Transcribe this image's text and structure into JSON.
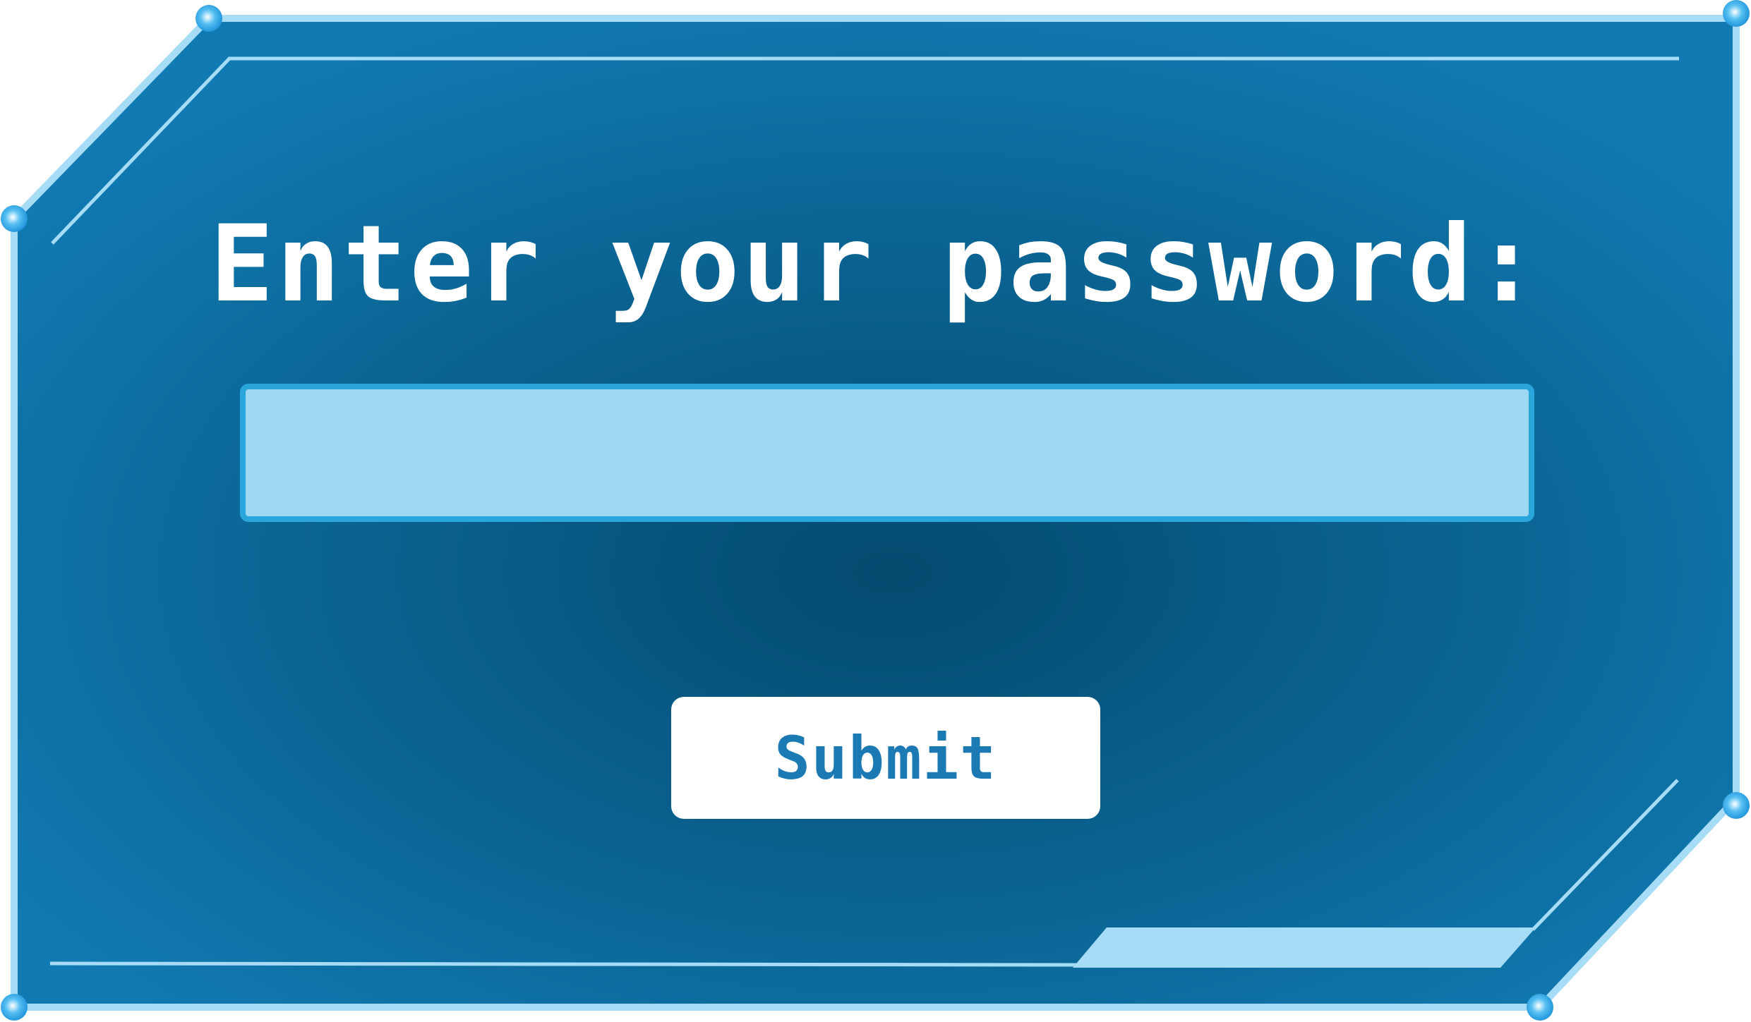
{
  "dialog": {
    "prompt": "Enter your password:",
    "password_field": {
      "value": "",
      "placeholder": ""
    },
    "submit_label": "Submit"
  },
  "colors": {
    "panel_outer": "#117ab2",
    "panel_inner": "#034a6e",
    "frame_border": "#a6dcf5",
    "field_fill": "#9fd8f3",
    "field_border": "#2aa6dc",
    "button_fill": "#ffffff",
    "button_text": "#1b7ab3",
    "prompt_text": "#ffffff"
  }
}
